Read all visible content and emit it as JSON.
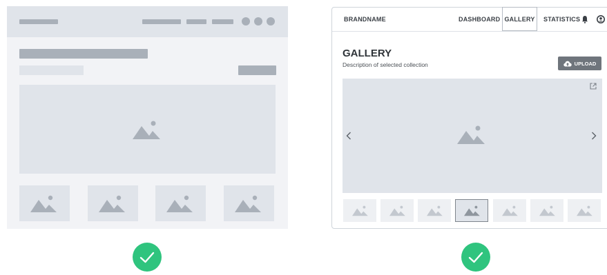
{
  "nav": {
    "brand": "BRANDNAME",
    "items": [
      {
        "label": "DASHBOARD"
      },
      {
        "label": "GALLERY"
      },
      {
        "label": "STATISTICS"
      }
    ]
  },
  "content": {
    "title": "GALLERY",
    "description": "Description of selected collection",
    "upload_label": "UPLOAD"
  },
  "thumbnails": {
    "count": 7,
    "selected_index": 3
  },
  "colors": {
    "accent_check": "#2fc47e",
    "wireframe_gray": "#a9b0b9",
    "button_gray": "#6f757c"
  }
}
